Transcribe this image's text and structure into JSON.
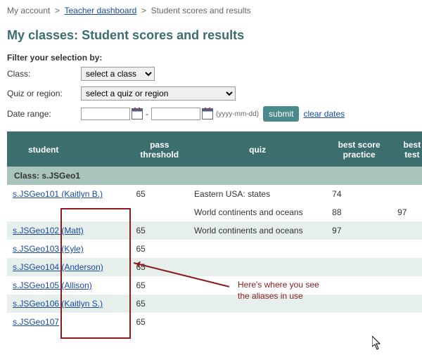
{
  "breadcrumb": {
    "home": "My account",
    "dash": "Teacher dashboard",
    "current": "Student scores and results"
  },
  "page_title": "My classes: Student scores and results",
  "filters": {
    "heading": "Filter your selection by:",
    "class_label": "Class:",
    "class_placeholder": "select a class",
    "quiz_label": "Quiz or region:",
    "quiz_placeholder": "select a quiz or region",
    "date_label": "Date range:",
    "date_sep": "-",
    "date_hint": "(yyyy-mm-dd)",
    "submit": "submit",
    "clear": "clear dates"
  },
  "table": {
    "headers": {
      "student": "student",
      "pass": "pass threshold",
      "quiz": "quiz",
      "bs1": "best score practice",
      "bs2": "best score test mode"
    },
    "group_label": "Class: s.JSGeo1",
    "rows": [
      {
        "student": "s.JSGeo101 (Kaitlyn B.)",
        "pass": "65",
        "quiz": "Eastern USA: states",
        "bs1": "74",
        "bs2": "",
        "alt": false
      },
      {
        "student": "",
        "pass": "",
        "quiz": "World continents and oceans",
        "bs1": "88",
        "bs2": "97",
        "alt": false
      },
      {
        "student": "s.JSGeo102 (Matt)",
        "pass": "65",
        "quiz": "World continents and oceans",
        "bs1": "97",
        "bs2": "",
        "alt": true
      },
      {
        "student": "s.JSGeo103 (Kyle)",
        "pass": "65",
        "quiz": "",
        "bs1": "",
        "bs2": "",
        "alt": false
      },
      {
        "student": "s.JSGeo104 (Anderson)",
        "pass": "65",
        "quiz": "",
        "bs1": "",
        "bs2": "",
        "alt": true
      },
      {
        "student": "s.JSGeo105 (Allison)",
        "pass": "65",
        "quiz": "",
        "bs1": "",
        "bs2": "",
        "alt": false
      },
      {
        "student": "s.JSGeo106 (Kaitlyn S.)",
        "pass": "65",
        "quiz": "",
        "bs1": "",
        "bs2": "",
        "alt": true
      },
      {
        "student": "s.JSGeo107",
        "pass": "65",
        "quiz": "",
        "bs1": "",
        "bs2": "",
        "alt": false
      }
    ]
  },
  "annotation": {
    "text": "Here's where you see\nthe aliases in use"
  }
}
